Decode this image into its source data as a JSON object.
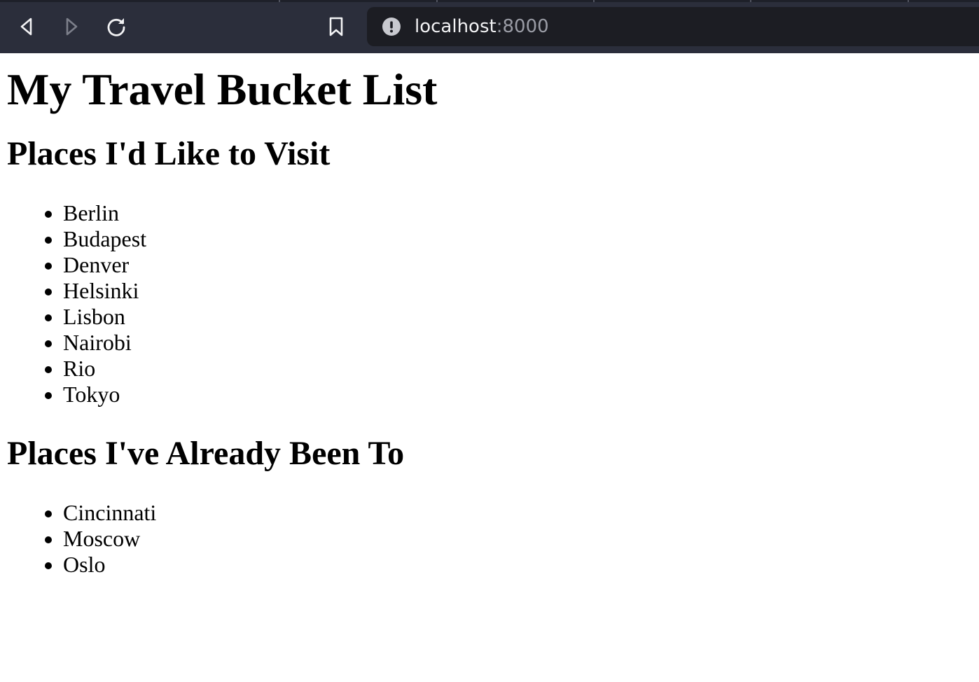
{
  "browser": {
    "back_icon": "back-arrow-icon",
    "forward_icon": "forward-arrow-icon",
    "reload_icon": "reload-icon",
    "bookmark_icon": "bookmark-icon",
    "info_icon": "info-icon",
    "url_host": "localhost",
    "url_port": ":8000"
  },
  "page": {
    "title": "My Travel Bucket List",
    "wishlist_heading": "Places I'd Like to Visit",
    "wishlist": [
      "Berlin",
      "Budapest",
      "Denver",
      "Helsinki",
      "Lisbon",
      "Nairobi",
      "Rio",
      "Tokyo"
    ],
    "visited_heading": "Places I've Already Been To",
    "visited": [
      "Cincinnati",
      "Moscow",
      "Oslo"
    ]
  }
}
